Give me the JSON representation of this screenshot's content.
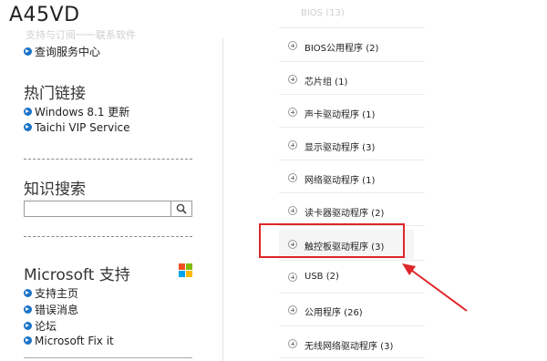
{
  "header": {
    "title": "A45VD",
    "faded_text": "支持与订阅一一联系软件"
  },
  "left": {
    "top_link": "查询服务中心",
    "hot_links": {
      "heading": "热门链接",
      "items": [
        "Windows 8.1 更新",
        "Taichi VIP Service"
      ]
    },
    "knowledge_search": {
      "heading": "知识搜索",
      "placeholder": "",
      "value": ""
    },
    "microsoft_support": {
      "heading": "Microsoft 支持",
      "items": [
        "支持主页",
        "错误消息",
        "论坛",
        "Microsoft Fix it"
      ],
      "logo_colors": [
        "#f25022",
        "#7fba00",
        "#00a4ef",
        "#ffb900"
      ]
    }
  },
  "right": {
    "faded_top": "BIOS (13)",
    "categories": [
      "BIOS公用程序 (2)",
      "芯片组 (1)",
      "声卡驱动程序 (1)",
      "显示驱动程序 (3)",
      "网络驱动程序 (1)",
      "读卡器驱动程序 (2)",
      "触控板驱动程序 (3)",
      "USB (2)",
      "公用程序 (26)",
      "无线网络驱动程序 (3)"
    ],
    "highlight_color": "#e0262a"
  }
}
